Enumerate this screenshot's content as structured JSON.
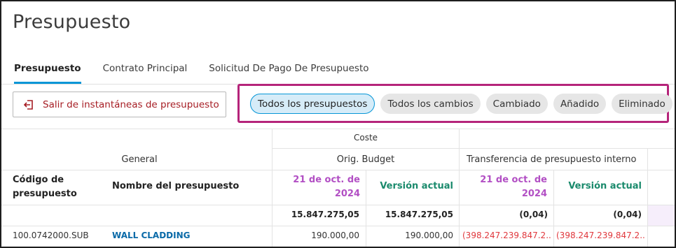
{
  "page": {
    "title": "Presupuesto"
  },
  "tabs": [
    {
      "label": "Presupuesto",
      "active": true
    },
    {
      "label": "Contrato Principal",
      "active": false
    },
    {
      "label": "Solicitud De Pago De Presupuesto",
      "active": false
    }
  ],
  "exit_button": {
    "label": "Salir de instantáneas de presupuesto",
    "icon": "exit-snapshot-icon"
  },
  "filters": [
    {
      "label": "Todos los presupuestos",
      "active": true
    },
    {
      "label": "Todos los cambios",
      "active": false
    },
    {
      "label": "Cambiado",
      "active": false
    },
    {
      "label": "Añadido",
      "active": false
    },
    {
      "label": "Eliminado",
      "active": false
    }
  ],
  "table": {
    "group_cost": "Coste",
    "group_general": "General",
    "group_orig_budget": "Orig. Budget",
    "group_internal_transfer": "Transferencia de presupuesto interno",
    "col_code": "Código de presupuesto",
    "col_name": "Nombre del presupuesto",
    "col_snapshot_date": "21 de oct. de 2024",
    "col_current_version": "Versión actual",
    "totals": {
      "orig_snapshot": "15.847.275,05",
      "orig_current": "15.847.275,05",
      "transfer_snapshot": "(0,04)",
      "transfer_current": "(0,04)"
    },
    "rows": [
      {
        "code": "100.0742000.SUB",
        "name": "WALL CLADDING",
        "orig_snapshot": "190.000,00",
        "orig_current": "190.000,00",
        "transfer_snapshot": "(398.247.239.847.2...",
        "transfer_current": "(398.247.239.847.2..."
      }
    ]
  },
  "colors": {
    "accent_blue": "#0696d7",
    "highlight_box": "#b5247a",
    "snapshot_purple": "#b24fc4",
    "current_green": "#1a8a6c",
    "negative_red": "#e0373c"
  }
}
